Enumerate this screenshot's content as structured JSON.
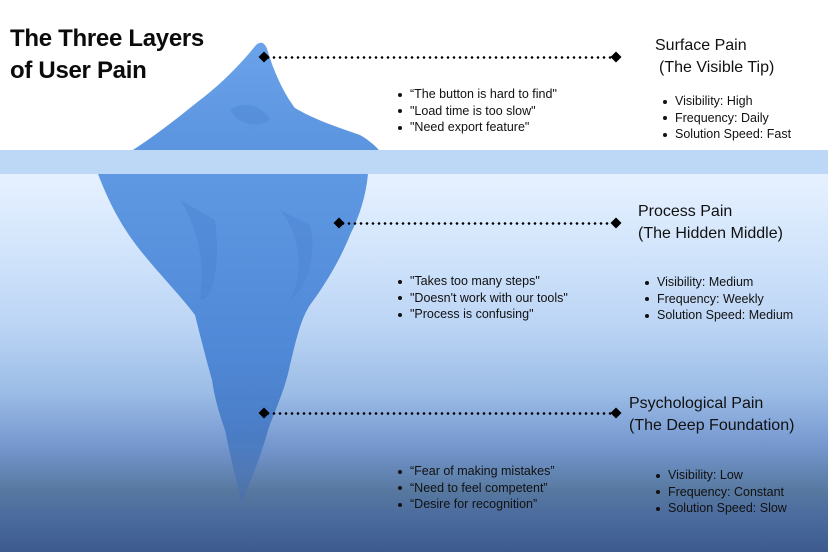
{
  "title": {
    "line1": "The Three Layers",
    "line2": "of User Pain"
  },
  "colors": {
    "iceberg": "#5b95e0",
    "iceberg_dark": "#3f78cc",
    "waterline": "#bcd8f6",
    "water_top": "#e6f1ff",
    "water_bottom": "#3c5a8e",
    "connector": "#000000"
  },
  "layers": [
    {
      "name": "Surface Pain",
      "subtitle": "(The Visible Tip)",
      "quotes": [
        "“The button is hard to find\"",
        "\"Load time is too slow\"",
        "\"Need export feature\""
      ],
      "attributes": [
        "Visibility: High",
        "Frequency: Daily",
        "Solution Speed: Fast"
      ]
    },
    {
      "name": "Process Pain",
      "subtitle": "(The Hidden Middle)",
      "quotes": [
        "\"Takes too many steps\"",
        "\"Doesn't work with our tools\"",
        "\"Process is confusing\""
      ],
      "attributes": [
        "Visibility: Medium",
        "Frequency: Weekly",
        "Solution Speed: Medium"
      ]
    },
    {
      "name": "Psychological Pain",
      "subtitle": "(The Deep Foundation)",
      "quotes": [
        "“Fear of making mistakes”",
        "“Need to feel competent”",
        "“Desire for recognition”"
      ],
      "attributes": [
        "Visibility: Low",
        "Frequency: Constant",
        "Solution Speed: Slow"
      ]
    }
  ]
}
